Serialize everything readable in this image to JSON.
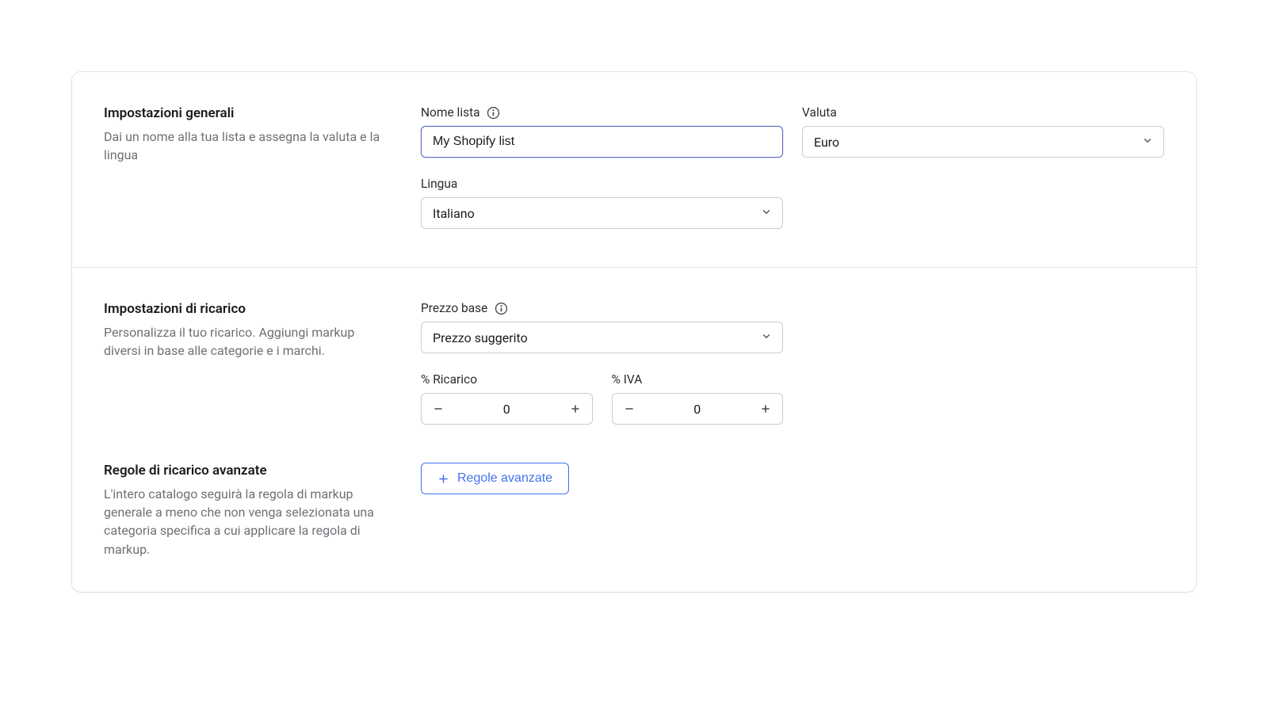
{
  "general": {
    "title": "Impostazioni generali",
    "description": "Dai un nome alla tua lista e assegna la valuta e la lingua",
    "listNameLabel": "Nome lista",
    "listNameValue": "My Shopify list",
    "currencyLabel": "Valuta",
    "currencyValue": "Euro",
    "languageLabel": "Lingua",
    "languageValue": "Italiano"
  },
  "markup": {
    "title": "Impostazioni di ricarico",
    "description": "Personalizza il tuo ricarico. Aggiungi markup diversi in base alle categorie e i marchi.",
    "basePriceLabel": "Prezzo base",
    "basePriceValue": "Prezzo suggerito",
    "markupPercentLabel": "% Ricarico",
    "markupPercentValue": "0",
    "vatPercentLabel": "% IVA",
    "vatPercentValue": "0"
  },
  "advanced": {
    "title": "Regole di ricarico avanzate",
    "description": "L'intero catalogo seguirà la regola di markup generale a meno che non venga selezionata una categoria specifica a cui applicare la regola di markup.",
    "buttonLabel": "Regole avanzate"
  }
}
